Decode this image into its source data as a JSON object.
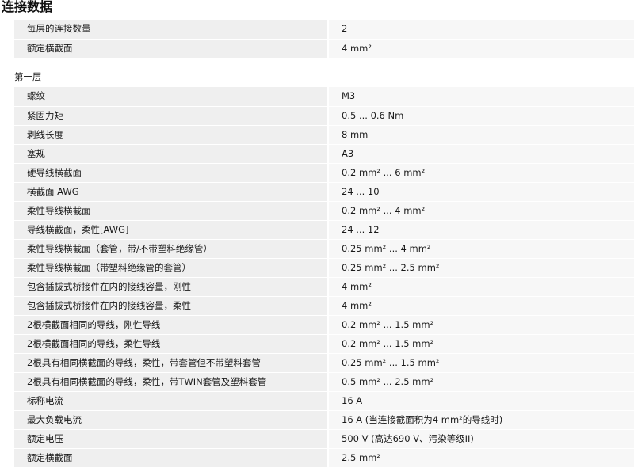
{
  "title": "连接数据",
  "general_rows": [
    {
      "label": "每层的连接数量",
      "value": "2"
    },
    {
      "label": "额定横截面",
      "value": "4 mm²"
    }
  ],
  "section_heading": "第一层",
  "level_rows": [
    {
      "label": "螺纹",
      "value": "M3"
    },
    {
      "label": "紧固力矩",
      "value": "0.5 ... 0.6 Nm"
    },
    {
      "label": "剥线长度",
      "value": "8 mm"
    },
    {
      "label": "塞规",
      "value": "A3"
    },
    {
      "label": "硬导线横截面",
      "value": "0.2 mm² ... 6 mm²"
    },
    {
      "label": "横截面 AWG",
      "value": "24 ... 10"
    },
    {
      "label": "柔性导线横截面",
      "value": "0.2 mm² ... 4 mm²"
    },
    {
      "label": "导线横截面，柔性[AWG]",
      "value": "24 ... 12"
    },
    {
      "label": "柔性导线横截面（套管，带/不带塑料绝缘管）",
      "value": "0.25 mm² ... 4 mm²"
    },
    {
      "label": "柔性导线横截面（带塑料绝缘管的套管）",
      "value": "0.25 mm² ... 2.5 mm²"
    },
    {
      "label": "包含插拔式桥接件在内的接线容量，刚性",
      "value": "4 mm²"
    },
    {
      "label": "包含插拔式桥接件在内的接线容量，柔性",
      "value": "4 mm²"
    },
    {
      "label": "2根横截面相同的导线，刚性导线",
      "value": "0.2 mm² ... 1.5 mm²"
    },
    {
      "label": "2根横截面相同的导线，柔性导线",
      "value": "0.2 mm² ... 1.5 mm²"
    },
    {
      "label": "2根具有相同横截面的导线，柔性，带套管但不带塑料套管",
      "value": "0.25 mm² ... 1.5 mm²"
    },
    {
      "label": "2根具有相同横截面的导线，柔性，带TWIN套管及塑料套管",
      "value": "0.5 mm² ... 2.5 mm²"
    },
    {
      "label": "标称电流",
      "value": "16 A"
    },
    {
      "label": "最大负载电流",
      "value": "16 A (当连接截面积为4 mm²的导线时)"
    },
    {
      "label": "额定电压",
      "value": "500 V (高达690 V、污染等级II)"
    },
    {
      "label": "额定横截面",
      "value": "2.5 mm²"
    }
  ]
}
